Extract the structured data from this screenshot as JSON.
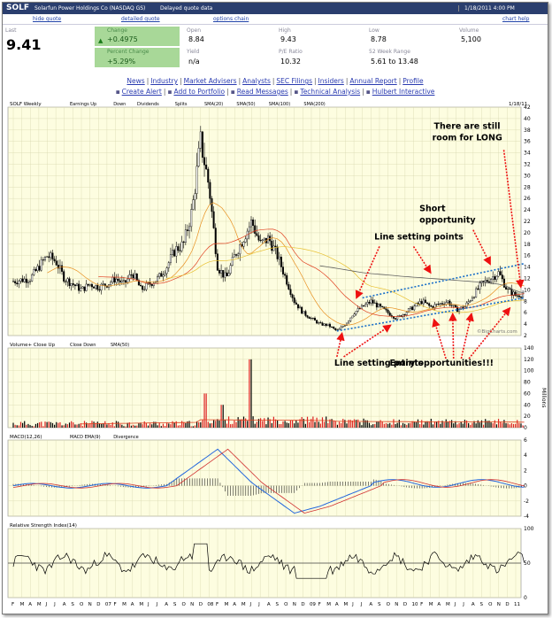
{
  "header": {
    "symbol": "SOLF",
    "company": "Solarfun Power Holdings Co (NASDAQ GS)",
    "quote_type": "Delayed quote data",
    "datetime": "1/18/2011 4:00 PM"
  },
  "links": {
    "hide_quote": "hide quote",
    "detailed_quote": "detailed quote",
    "options_chain": "options chain",
    "chart_help": "chart help"
  },
  "quote": {
    "last_label": "Last",
    "last": "9.41",
    "change_label": "Change",
    "change": "+0.4975",
    "pct_label": "Percent Change",
    "pct": "+5.29%",
    "open_label": "Open",
    "open": "8.84",
    "yield_label": "Yield",
    "yield": "n/a",
    "high_label": "High",
    "high": "9.43",
    "pe_label": "P/E Ratio",
    "pe": "10.32",
    "low_label": "Low",
    "low": "8.78",
    "range_label": "52 Week Range",
    "range": "5.61 to 13.48",
    "volume_label": "Volume",
    "volume": "5,100"
  },
  "nav1": [
    "News",
    "Industry",
    "Market Advisers",
    "Analysts",
    "SEC Filings",
    "Insiders",
    "Annual Report",
    "Profile"
  ],
  "nav2": [
    "Create Alert",
    "Add to Portfolio",
    "Read Messages",
    "Technical Analysis",
    "Hulbert Interactive"
  ],
  "colors": {
    "bg": "#fdfde0",
    "grid": "#d8d8b0",
    "price": "#000000",
    "sma20": "#e89020",
    "sma50": "#e04020",
    "sma100": "#e8c030",
    "sma200": "#606060",
    "channel": "#1a6fc8",
    "arrow": "#ee1111",
    "macd": "#2266dd",
    "signal": "#d03030"
  },
  "chart_data": [
    {
      "type": "candlestick",
      "title": "SOLF Weekly",
      "date_label": "1/18/11",
      "legend": [
        "Earnings Up",
        "Down",
        "Dividends",
        "Splits",
        "SMA(20)",
        "SMA(50)",
        "SMA(100)",
        "SMA(200)"
      ],
      "ylim": [
        2,
        42
      ],
      "yticks": [
        2,
        4,
        6,
        8,
        10,
        12,
        14,
        16,
        18,
        20,
        22,
        24,
        26,
        28,
        30,
        32,
        34,
        36,
        38,
        40,
        42
      ],
      "x_labels": [
        "F",
        "M",
        "A",
        "M",
        "J",
        "J",
        "A",
        "S",
        "O",
        "N",
        "D",
        "07",
        "F",
        "M",
        "A",
        "M",
        "J",
        "J",
        "A",
        "S",
        "O",
        "N",
        "D",
        "08",
        "F",
        "M",
        "A",
        "M",
        "J",
        "J",
        "A",
        "S",
        "O",
        "N",
        "D",
        "09",
        "F",
        "M",
        "A",
        "M",
        "J",
        "J",
        "A",
        "S",
        "O",
        "N",
        "D",
        "10",
        "F",
        "M",
        "A",
        "M",
        "J",
        "J",
        "A",
        "S",
        "O",
        "N",
        "D",
        "11"
      ],
      "price_path": [
        [
          0,
          11.5
        ],
        [
          2,
          12
        ],
        [
          3,
          14
        ],
        [
          4,
          16
        ],
        [
          5,
          15
        ],
        [
          6,
          12
        ],
        [
          7,
          11
        ],
        [
          8,
          10
        ],
        [
          9,
          11
        ],
        [
          10,
          10.5
        ],
        [
          11,
          11
        ],
        [
          12,
          12
        ],
        [
          13,
          11
        ],
        [
          14,
          13
        ],
        [
          15,
          10
        ],
        [
          16,
          11
        ],
        [
          17,
          12
        ],
        [
          18,
          14
        ],
        [
          19,
          17
        ],
        [
          20,
          18
        ],
        [
          21,
          24
        ],
        [
          22,
          36
        ],
        [
          23,
          28
        ],
        [
          24,
          14
        ],
        [
          25,
          12
        ],
        [
          26,
          16
        ],
        [
          27,
          19
        ],
        [
          28,
          22
        ],
        [
          29,
          18
        ],
        [
          30,
          19
        ],
        [
          31,
          16
        ],
        [
          32,
          12
        ],
        [
          33,
          8
        ],
        [
          34,
          6
        ],
        [
          35,
          5
        ],
        [
          36,
          4
        ],
        [
          37,
          3.8
        ],
        [
          38,
          2.8
        ],
        [
          39,
          4
        ],
        [
          40,
          6
        ],
        [
          41,
          7
        ],
        [
          42,
          8
        ],
        [
          43,
          7
        ],
        [
          44,
          6
        ],
        [
          45,
          5
        ],
        [
          46,
          6
        ],
        [
          47,
          7
        ],
        [
          48,
          8
        ],
        [
          49,
          7
        ],
        [
          50,
          7.5
        ],
        [
          51,
          8
        ],
        [
          52,
          6.5
        ],
        [
          53,
          7
        ],
        [
          54,
          9
        ],
        [
          55,
          11
        ],
        [
          56,
          12
        ],
        [
          57,
          13
        ],
        [
          58,
          10
        ],
        [
          59,
          9
        ],
        [
          60,
          9.4
        ]
      ],
      "annotations": [
        "Line setting points",
        "Short opportunity",
        "There are still room for LONG",
        "Line setting points",
        "Entry opportunities!!!"
      ],
      "watermark": "©BigCharts.com"
    },
    {
      "type": "bar",
      "title": "Volume+ Close Up",
      "legend": [
        "Close Down",
        "SMA(50)"
      ],
      "ylabel": "Millions",
      "yticks": [
        0,
        20,
        40,
        60,
        80,
        100,
        120,
        140
      ],
      "ylim": [
        0,
        140
      ]
    },
    {
      "type": "line",
      "title": "MACD(12,26)",
      "legend": [
        "MACD EMA(9)",
        "Divergence"
      ],
      "yticks": [
        -4,
        -2,
        0,
        2,
        4,
        6
      ],
      "ylim": [
        -4,
        6
      ]
    },
    {
      "type": "line",
      "title": "Relative Strength Index(14)",
      "yticks": [
        0,
        50,
        100
      ],
      "ylim": [
        0,
        100
      ]
    }
  ]
}
